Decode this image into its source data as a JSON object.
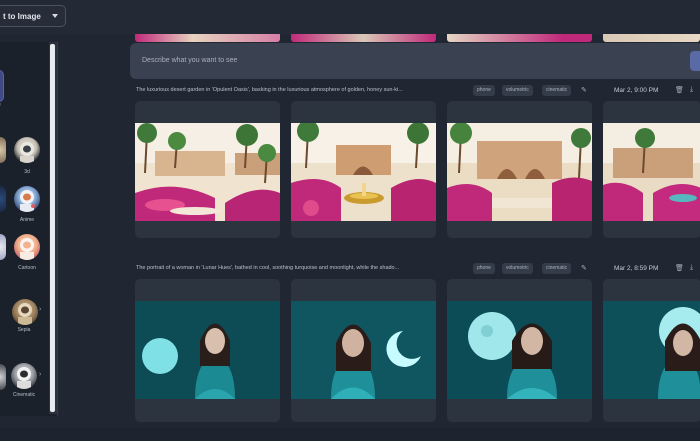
{
  "topbar": {
    "mode_label": "t to Image"
  },
  "sidebar": {
    "styles": [
      {
        "id": "3d",
        "label": "3d"
      },
      {
        "id": "anime",
        "label": "Anime"
      },
      {
        "id": "cartoon",
        "label": "Cartoon"
      },
      {
        "id": "sepia",
        "label": "Sepia"
      },
      {
        "id": "cinematic",
        "label": "Cinematic"
      }
    ],
    "selected_label_fragment": "e"
  },
  "prompt": {
    "placeholder": "Describe what you want to see"
  },
  "generations": [
    {
      "prompt": "The luxurious desert garden in 'Opulent Oasis', basking in the luxurious atmosphere of golden, honey sun-ki...",
      "tags": [
        "phone",
        "volumetric",
        "cinematic"
      ],
      "date": "Mar 2, 9:00 PM"
    },
    {
      "prompt": "The portrait of a woman in 'Lunar Hues', bathed in cool, soothing turquoise and moonlight, while the shado...",
      "tags": [
        "phone",
        "volumetric",
        "cinematic"
      ],
      "date": "Mar 2, 8:59 PM"
    }
  ],
  "colors": {
    "background": "#202733",
    "card": "#2c3440",
    "accent": "#5a6aa6",
    "magenta": "#c0297a",
    "teal": "#1fa7b0"
  },
  "icons": {
    "edit": "pencil-icon",
    "delete": "trash-icon",
    "download": "download-icon",
    "dropdown": "chevron-down-icon"
  }
}
